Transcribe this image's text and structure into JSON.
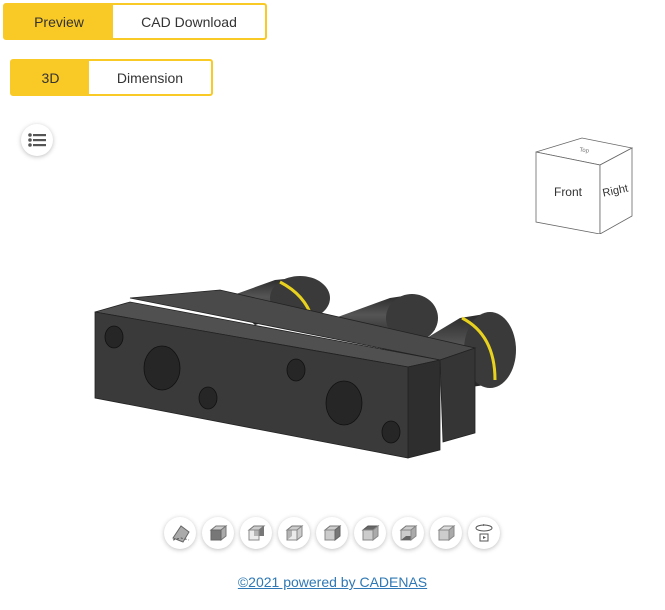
{
  "main_tabs": [
    {
      "label": "Preview",
      "active": true
    },
    {
      "label": "CAD Download",
      "active": false
    }
  ],
  "view_tabs": [
    {
      "label": "3D",
      "active": true
    },
    {
      "label": "Dimension",
      "active": false
    }
  ],
  "menu_button": {
    "icon": "list-icon"
  },
  "view_cube": {
    "front": "Front",
    "right": "Right",
    "top": "Top"
  },
  "toolbar": [
    {
      "icon": "isometric-view-icon"
    },
    {
      "icon": "front-view-icon"
    },
    {
      "icon": "back-view-icon"
    },
    {
      "icon": "left-view-icon"
    },
    {
      "icon": "right-view-icon"
    },
    {
      "icon": "top-view-icon"
    },
    {
      "icon": "bottom-view-icon"
    },
    {
      "icon": "fit-view-icon"
    },
    {
      "icon": "rotate-animation-icon"
    }
  ],
  "footer": {
    "link_text": "©2021 powered by CADENAS"
  },
  "colors": {
    "accent": "#f9c926",
    "link": "#2e78b5",
    "model": "#3a3a3a",
    "ring": "#e8d21e"
  }
}
